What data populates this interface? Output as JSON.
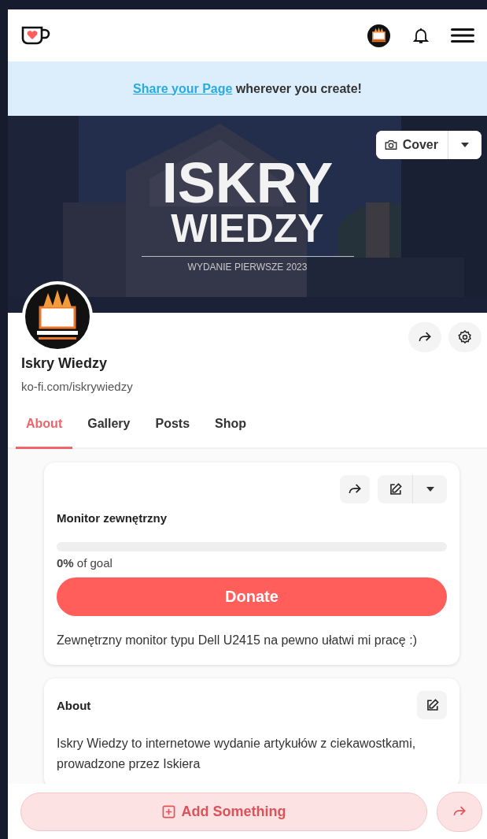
{
  "banner": {
    "link": "Share your Page",
    "text": " wherever you create!"
  },
  "cover": {
    "title_line_1": "ISKRY",
    "title_line_2": "WIEDZY",
    "subtitle": "WYDANIE PIERWSZE 2023",
    "button": "Cover"
  },
  "profile": {
    "name": "Iskry Wiedzy",
    "url": "ko-fi.com/iskrywiedzy"
  },
  "tabs": [
    {
      "label": "About",
      "selected": true
    },
    {
      "label": "Gallery",
      "selected": false
    },
    {
      "label": "Posts",
      "selected": false
    },
    {
      "label": "Shop",
      "selected": false
    }
  ],
  "goal": {
    "title": "Monitor zewnętrzny",
    "level": 0,
    "percent": "0%",
    "percent_suffix": " of goal",
    "button": "Donate",
    "description": "Zewnętrzny monitor typu Dell U2415 na pewno ułatwi mi pracę :)"
  },
  "about": {
    "title": "About",
    "text": "Iskry Wiedzy to internetowe wydanie artykułów z ciekawostkami, prowadzone przez Iskiera"
  },
  "bottom_bar": {
    "button": "Add Something"
  }
}
